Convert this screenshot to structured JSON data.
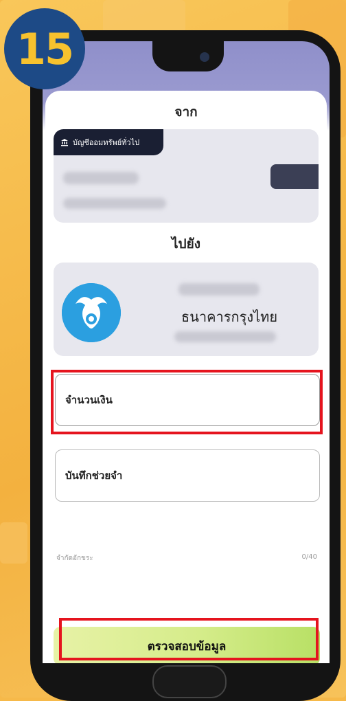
{
  "step_badge": "15",
  "from": {
    "heading": "จาก",
    "account_type": "บัญชีออมทรัพย์ทั่วไป",
    "bank_icon": "bank-icon"
  },
  "to": {
    "heading": "ไปยัง",
    "bank_name": "ธนาคารกรุงไทย",
    "logo": "krungthai-bank-logo"
  },
  "form": {
    "amount_placeholder": "จำนวนเงิน",
    "memo_placeholder": "บันทึกช่วยจำ",
    "char_limit_label": "จำกัดอักขระ",
    "char_count": "0/40"
  },
  "confirm_button": "ตรวจสอบข้อมูล",
  "colors": {
    "highlight": "#e5141e",
    "badge_bg": "#1d4a86",
    "badge_text": "#f7c22e",
    "button_gradient_start": "#e7f2a6",
    "button_gradient_end": "#b8e065"
  }
}
